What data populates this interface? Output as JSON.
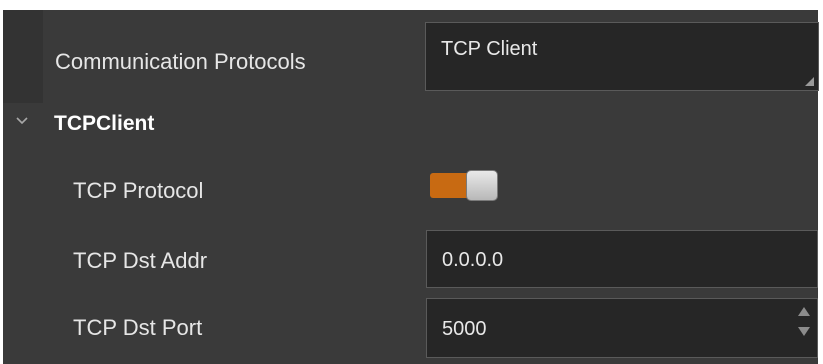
{
  "communication": {
    "label": "Communication Protocols",
    "value": "TCP Client"
  },
  "section": {
    "title": "TCPClient",
    "chevron_icon": "chevron-down-icon"
  },
  "fields": {
    "tcp_protocol": {
      "label": "TCP Protocol",
      "enabled": true,
      "on_color": "#c86a12"
    },
    "tcp_dst_addr": {
      "label": "TCP Dst Addr",
      "value": "0.0.0.0"
    },
    "tcp_dst_port": {
      "label": "TCP Dst Port",
      "value": "5000"
    }
  },
  "colors": {
    "background": "#3a3a3a",
    "input_background": "#262626",
    "text": "#e6e6e6",
    "accent": "#c86a12"
  }
}
